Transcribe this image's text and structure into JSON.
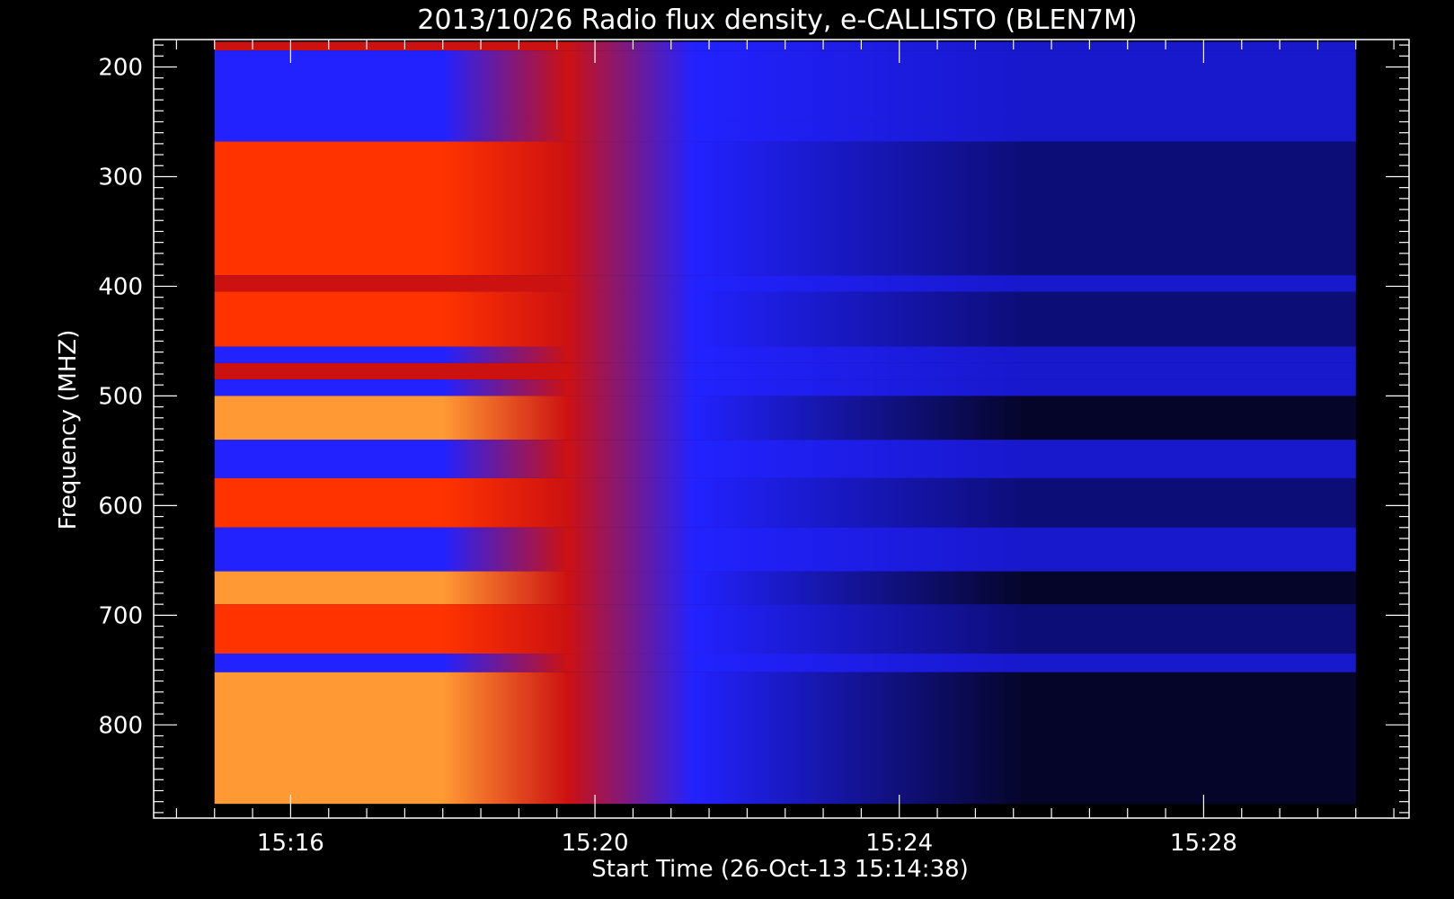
{
  "chart_data": {
    "type": "heatmap",
    "title": "2013/10/26  Radio flux density, e-CALLISTO (BLEN7M)",
    "xlabel": "Start Time (26-Oct-13 15:14:38)",
    "ylabel": "Frequency (MHZ)",
    "x_ticks": [
      "15:16",
      "15:20",
      "15:24",
      "15:28"
    ],
    "x_tick_minutes": [
      16,
      20,
      24,
      28
    ],
    "y_ticks": [
      "200",
      "300",
      "400",
      "500",
      "600",
      "700",
      "800"
    ],
    "y_tick_values": [
      200,
      300,
      400,
      500,
      600,
      700,
      800
    ],
    "xlim_minutes": [
      14.2,
      30.7
    ],
    "ylim": [
      175,
      885
    ],
    "data_extent": {
      "time_start_minutes": 15.0,
      "time_end_minutes": 30.0,
      "freq_min": 177,
      "freq_max": 872
    },
    "burst_fade_minutes": [
      18.0,
      21.3
    ],
    "colormap": [
      "#000000",
      "#0a0a66",
      "#2222ff",
      "#cc1111",
      "#ff3300",
      "#ff9933",
      "#ffcc88"
    ],
    "bands": [
      {
        "from": 177,
        "to": 185,
        "level": 0.6
      },
      {
        "from": 185,
        "to": 250,
        "level": 0.4
      },
      {
        "from": 250,
        "to": 268,
        "level": 0.35
      },
      {
        "from": 268,
        "to": 390,
        "level": 0.85
      },
      {
        "from": 390,
        "to": 405,
        "level": 0.55
      },
      {
        "from": 405,
        "to": 455,
        "level": 0.85
      },
      {
        "from": 455,
        "to": 470,
        "level": 0.5
      },
      {
        "from": 470,
        "to": 485,
        "level": 0.55
      },
      {
        "from": 485,
        "to": 500,
        "level": 0.45
      },
      {
        "from": 500,
        "to": 540,
        "level": 0.95
      },
      {
        "from": 540,
        "to": 575,
        "level": 0.5
      },
      {
        "from": 575,
        "to": 620,
        "level": 0.9
      },
      {
        "from": 620,
        "to": 660,
        "level": 0.45
      },
      {
        "from": 660,
        "to": 690,
        "level": 1.0
      },
      {
        "from": 690,
        "to": 735,
        "level": 0.75
      },
      {
        "from": 735,
        "to": 752,
        "level": 0.4
      },
      {
        "from": 752,
        "to": 872,
        "level": 1.0
      }
    ]
  }
}
